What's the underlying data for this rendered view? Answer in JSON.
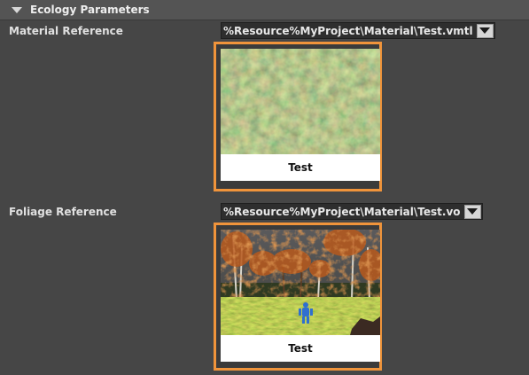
{
  "section": {
    "title": "Ecology Parameters",
    "icon": "collapse-triangle-icon"
  },
  "material": {
    "label": "Material Reference",
    "path": "%Resource%MyProject\\Material\\Test.vmtl",
    "thumbnail_caption": "Test",
    "dropdown_icon": "dropdown-arrow-icon"
  },
  "foliage": {
    "label": "Foliage Reference",
    "path": "%Resource%MyProject\\Material\\Test.vo",
    "thumbnail_caption": "Test",
    "dropdown_icon": "dropdown-arrow-icon"
  },
  "colors": {
    "accent_border": "#f0943b",
    "panel_bg": "#464646",
    "header_bg": "#545454"
  }
}
